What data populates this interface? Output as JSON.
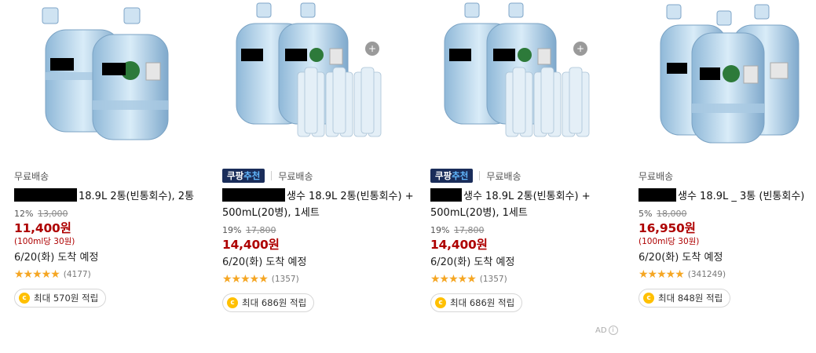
{
  "products": [
    {
      "badge": null,
      "shipping": "무료배송",
      "title": "18.9L 2통(빈통회수), 2통",
      "discount": "12%",
      "original_price": "13,000",
      "price": "11,400원",
      "unit_price": "(100ml당 30원)",
      "arrival": "6/20(화) 도착 예정",
      "stars": "★★★★★",
      "review_count": "(4177)",
      "reward": "최대 570원 적립"
    },
    {
      "badge": {
        "part1": "쿠팡",
        "part2": "추천"
      },
      "shipping": "무료배송",
      "title": "생수 18.9L 2통(빈통회수) + 500mL(20병), 1세트",
      "discount": "19%",
      "original_price": "17,800",
      "price": "14,400원",
      "unit_price": "",
      "arrival": "6/20(화) 도착 예정",
      "stars": "★★★★★",
      "review_count": "(1357)",
      "reward": "최대 686원 적립"
    },
    {
      "badge": {
        "part1": "쿠팡",
        "part2": "추천"
      },
      "shipping": "무료배송",
      "title": "생수 18.9L 2통(빈통회수) + 500mL(20병), 1세트",
      "discount": "19%",
      "original_price": "17,800",
      "price": "14,400원",
      "unit_price": "",
      "arrival": "6/20(화) 도착 예정",
      "stars": "★★★★★",
      "review_count": "(1357)",
      "reward": "최대 686원 적립"
    },
    {
      "badge": null,
      "shipping": "무료배송",
      "title": "생수 18.9L _ 3통 (빈통회수)",
      "discount": "5%",
      "original_price": "18,000",
      "price": "16,950원",
      "unit_price": "(100ml당 30원)",
      "arrival": "6/20(화) 도착 예정",
      "stars": "★★★★★",
      "review_count": "(341249)",
      "reward": "최대 848원 적립"
    }
  ],
  "ad_label": "AD",
  "ad_info_icon": "i"
}
